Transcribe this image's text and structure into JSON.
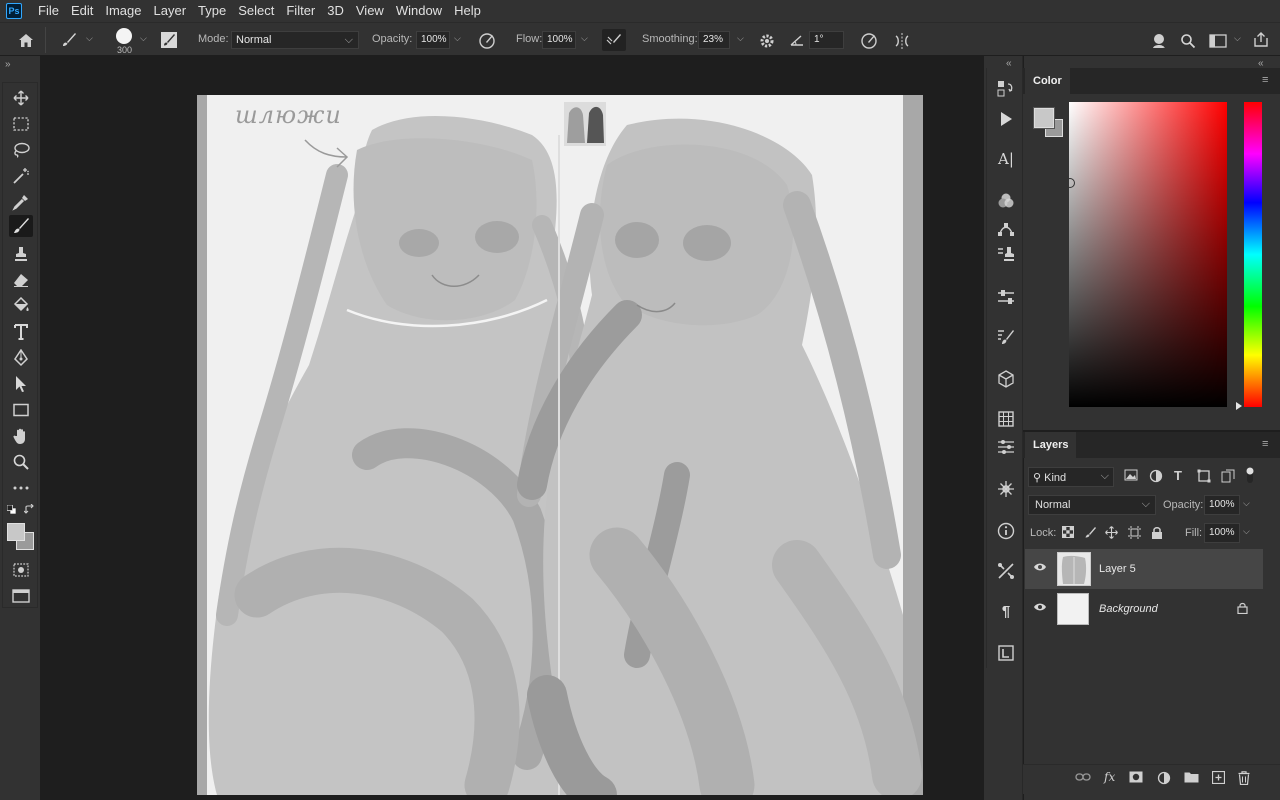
{
  "app": {
    "logo": "Ps"
  },
  "menu": [
    "File",
    "Edit",
    "Image",
    "Layer",
    "Type",
    "Select",
    "Filter",
    "3D",
    "View",
    "Window",
    "Help"
  ],
  "options": {
    "brush_size": "300",
    "mode_label": "Mode:",
    "mode_value": "Normal",
    "opacity_label": "Opacity:",
    "opacity_value": "100%",
    "flow_label": "Flow:",
    "flow_value": "100%",
    "smoothing_label": "Smoothing:",
    "smoothing_value": "23%",
    "angle_value": "1°"
  },
  "canvas": {
    "handwriting": "шлюжи",
    "bg": "#f0f0f0"
  },
  "color_panel": {
    "tab": "Color",
    "foreground": "#c8c8c8",
    "background": "#9a9a9a",
    "hue": "#ff0000"
  },
  "layers_panel": {
    "tab": "Layers",
    "kind_label": "Kind",
    "blend_mode": "Normal",
    "opacity_label": "Opacity:",
    "opacity_value": "100%",
    "lock_label": "Lock:",
    "fill_label": "Fill:",
    "fill_value": "100%",
    "layers": [
      {
        "name": "Layer 5",
        "selected": true
      },
      {
        "name": "Background",
        "locked": true
      }
    ]
  },
  "icons": {
    "home": "home-icon",
    "search": "search-icon"
  }
}
